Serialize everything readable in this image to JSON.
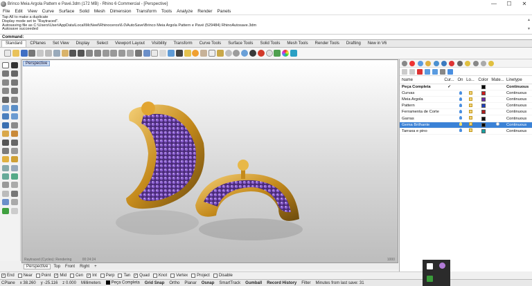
{
  "window": {
    "title": "Brinco Meia Argola Pattern e Pavé.3dm (172 MB) - Rhino 6 Commercial - [Perspective]",
    "minimize": "—",
    "maximize": "☐",
    "close": "✕"
  },
  "menu": [
    "File",
    "Edit",
    "View",
    "Curve",
    "Surface",
    "Solid",
    "Mesh",
    "Dimension",
    "Transform",
    "Tools",
    "Analyze",
    "Render",
    "Panels"
  ],
  "history": [
    "Tap All to make a duplicate",
    "Display mode set to \"Raytraced\".",
    "Autosaving file as C:\\Users\\User\\AppData\\Local\\McNeel\\Rhinoceros\\6.0\\AutoSave\\Brinco Meia Argola Pattern e Pavé (529484) RhinoAutosave.3dm",
    "Autosave succeeded"
  ],
  "command": {
    "label": "Command:",
    "value": ""
  },
  "tool_tabs": [
    "Standard",
    "CPlanes",
    "Set View",
    "Display",
    "Select",
    "Viewport Layout",
    "Visibility",
    "Transform",
    "Curve Tools",
    "Surface Tools",
    "Solid Tools",
    "Mesh Tools",
    "Render Tools",
    "Drafting",
    "New in V6"
  ],
  "viewport": {
    "label": "Perspective",
    "status": "Raytraced (Cycles): Rendering",
    "status_time": "00:24:24",
    "status_right": "1000",
    "tabs": [
      "Perspective",
      "Top",
      "Front",
      "Right",
      "+"
    ]
  },
  "osnaps": [
    {
      "label": "End",
      "checked": true
    },
    {
      "label": "Near",
      "checked": false
    },
    {
      "label": "Point",
      "checked": false
    },
    {
      "label": "Mid",
      "checked": true
    },
    {
      "label": "Cen",
      "checked": false
    },
    {
      "label": "Int",
      "checked": true
    },
    {
      "label": "Perp",
      "checked": false
    },
    {
      "label": "Tan",
      "checked": false
    },
    {
      "label": "Quad",
      "checked": true
    },
    {
      "label": "Knot",
      "checked": false
    },
    {
      "label": "Vertex",
      "checked": false
    },
    {
      "label": "Project",
      "checked": false
    },
    {
      "label": "Disable",
      "checked": false
    }
  ],
  "status": {
    "cplane": "CPlane",
    "x": "x 38.260",
    "y": "y -25.116",
    "z": "z 0.000",
    "units": "Millimeters",
    "layer": "Peça Completa",
    "grid_snap": "Grid Snap",
    "ortho": "Ortho",
    "planar": "Planar",
    "osnap": "Osnap",
    "smarttrack": "SmartTrack",
    "gumball": "Gumball",
    "record_history": "Record History",
    "filter": "Filter",
    "last_save": "Minutes from last save: 31"
  },
  "layers": {
    "headers": {
      "name": "Name",
      "current": "Cur...",
      "on": "On",
      "lock": "Lo...",
      "color": "Color",
      "material": "Mate...",
      "linetype": "Linetype"
    },
    "rows": [
      {
        "name": "Peça Completa",
        "current": "✓",
        "color": "#000000",
        "linetype": "Continuous",
        "bold": true,
        "selected": false
      },
      {
        "name": "Curvas",
        "current": "",
        "color": "#d11b1b",
        "linetype": "Continuous",
        "bold": false,
        "selected": false
      },
      {
        "name": "Meia Argola",
        "current": "",
        "color": "#6a2aa8",
        "linetype": "Continuous",
        "bold": false,
        "selected": false
      },
      {
        "name": "Pattern",
        "current": "",
        "color": "#1e3fbf",
        "linetype": "Continuous",
        "bold": false,
        "selected": false
      },
      {
        "name": "Ferramenta de Corte",
        "current": "",
        "color": "#b01c1c",
        "linetype": "Continuous",
        "bold": false,
        "selected": false
      },
      {
        "name": "Garras",
        "current": "",
        "color": "#111111",
        "linetype": "Continuous",
        "bold": false,
        "selected": false
      },
      {
        "name": "Gema Brilhante",
        "current": "",
        "color": "#000000",
        "linetype": "Continuous",
        "bold": false,
        "selected": true
      },
      {
        "name": "Tarraxa e pino",
        "current": "",
        "color": "#18a3a3",
        "linetype": "Continuous",
        "bold": false,
        "selected": false
      }
    ]
  },
  "colors": {
    "accent": "#3b82d6",
    "gold": "#d9a531",
    "gem": "#6d3fa8"
  }
}
